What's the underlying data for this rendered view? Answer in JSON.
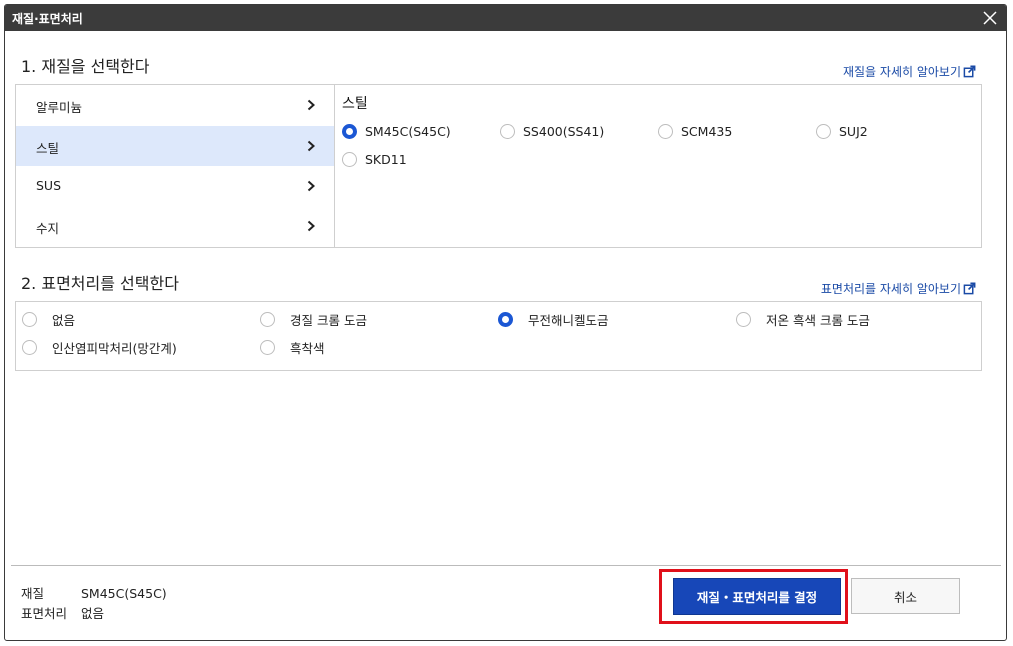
{
  "window": {
    "title": "재질·표면처리"
  },
  "section1": {
    "title": "1. 재질을 선택한다",
    "more_link": "재질을 자세히 알아보기",
    "categories": [
      {
        "label": "알루미늄",
        "selected": false
      },
      {
        "label": "스틸",
        "selected": true
      },
      {
        "label": "SUS",
        "selected": false
      },
      {
        "label": "수지",
        "selected": false
      }
    ],
    "material_group_title": "스틸",
    "materials": [
      {
        "label": "SM45C(S45C)",
        "selected": true
      },
      {
        "label": "SS400(SS41)",
        "selected": false
      },
      {
        "label": "SCM435",
        "selected": false
      },
      {
        "label": "SUJ2",
        "selected": false
      },
      {
        "label": "SKD11",
        "selected": false
      }
    ]
  },
  "section2": {
    "title": "2. 표면처리를 선택한다",
    "more_link": "표면처리를 자세히 알아보기",
    "treatments": [
      {
        "label": "없음",
        "selected": false
      },
      {
        "label": "경질 크롬 도금",
        "selected": false
      },
      {
        "label": "무전해니켈도금",
        "selected": true
      },
      {
        "label": "저온 흑색 크롬 도금",
        "selected": false
      },
      {
        "label": "인산염피막처리(망간계)",
        "selected": false
      },
      {
        "label": "흑착색",
        "selected": false
      }
    ]
  },
  "summary": {
    "material_label": "재질",
    "material_value": "SM45C(S45C)",
    "treatment_label": "표면처리",
    "treatment_value": "없음"
  },
  "buttons": {
    "confirm": "재질・표면처리를 결정",
    "cancel": "취소"
  },
  "colors": {
    "accent": "#1747b8",
    "selected_row": "#dde8fb",
    "highlight": "#e0101a",
    "link": "#1a4aa6"
  }
}
